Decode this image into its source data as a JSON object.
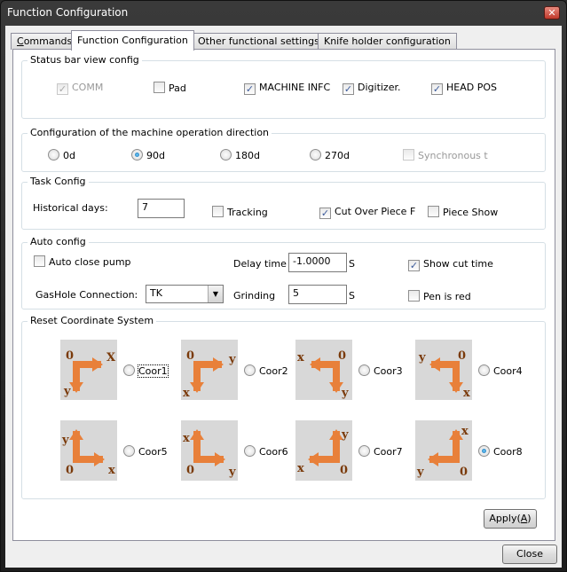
{
  "window": {
    "title": "Function Configuration",
    "close_glyph": "✕"
  },
  "tabs": [
    {
      "label": "Commands",
      "mnemonic": "C",
      "rest": "ommands",
      "active": false
    },
    {
      "label": "Function Configuration",
      "active": true
    },
    {
      "label": "Other functional settings",
      "active": false
    },
    {
      "label": "Knife holder configuration",
      "active": false
    }
  ],
  "status_bar": {
    "label": "Status bar view config",
    "items": [
      {
        "label": "COMM",
        "checked": true,
        "disabled": true
      },
      {
        "label": "Pad",
        "checked": false,
        "disabled": false
      },
      {
        "label": "MACHINE INFC",
        "checked": true,
        "disabled": false
      },
      {
        "label": "Digitizer.",
        "checked": true,
        "disabled": false
      },
      {
        "label": "HEAD POS",
        "checked": true,
        "disabled": false
      }
    ]
  },
  "direction": {
    "label": "Configuration of the machine operation direction",
    "options": [
      {
        "label": "0d",
        "selected": false
      },
      {
        "label": "90d",
        "selected": true
      },
      {
        "label": "180d",
        "selected": false
      },
      {
        "label": "270d",
        "selected": false
      }
    ],
    "sync": {
      "label": "Synchronous t",
      "checked": false,
      "disabled": true
    }
  },
  "task": {
    "label": "Task Config",
    "historical_days_label": "Historical days:",
    "historical_days_value": "7",
    "tracking": {
      "label": "Tracking",
      "checked": false
    },
    "cut_over": {
      "label": "Cut Over Piece F",
      "checked": true
    },
    "piece_show": {
      "label": "Piece Show",
      "checked": false
    }
  },
  "auto": {
    "label": "Auto config",
    "auto_close_pump": {
      "label": "Auto close pump",
      "checked": false
    },
    "delay_time_label": "Delay time",
    "delay_time_value": "-1.0000",
    "delay_unit": "S",
    "show_cut_time": {
      "label": "Show cut time",
      "checked": true
    },
    "gashole_label": "GasHole Connection:",
    "gashole_value": "TK",
    "grinding_label": "Grinding",
    "grinding_value": "5",
    "grinding_unit": "S",
    "pen_is_red": {
      "label": "Pen is red",
      "checked": false
    }
  },
  "reset": {
    "label": "Reset Coordinate System",
    "coords": [
      {
        "label": "Coor1",
        "origin": "0",
        "a": "X",
        "b": "y",
        "selected": false,
        "focused": true
      },
      {
        "label": "Coor2",
        "origin": "0",
        "a": "y",
        "b": "x",
        "selected": false
      },
      {
        "label": "Coor3",
        "origin": "0",
        "a": "x",
        "b": "y",
        "selected": false
      },
      {
        "label": "Coor4",
        "origin": "0",
        "a": "y",
        "b": "x",
        "selected": false
      },
      {
        "label": "Coor5",
        "origin": "0",
        "a": "y",
        "b": "x",
        "selected": false
      },
      {
        "label": "Coor6",
        "origin": "0",
        "a": "x",
        "b": "y",
        "selected": false
      },
      {
        "label": "Coor7",
        "origin": "0",
        "a": "y",
        "b": "x",
        "selected": false
      },
      {
        "label": "Coor8",
        "origin": "0",
        "a": "x",
        "b": "y",
        "selected": true
      }
    ],
    "arrow_color": "#e8803a",
    "label_color": "#7a3a0a"
  },
  "buttons": {
    "apply_prefix": "Apply(",
    "apply_mnemonic": "A",
    "apply_suffix": ")",
    "close": "Close"
  }
}
